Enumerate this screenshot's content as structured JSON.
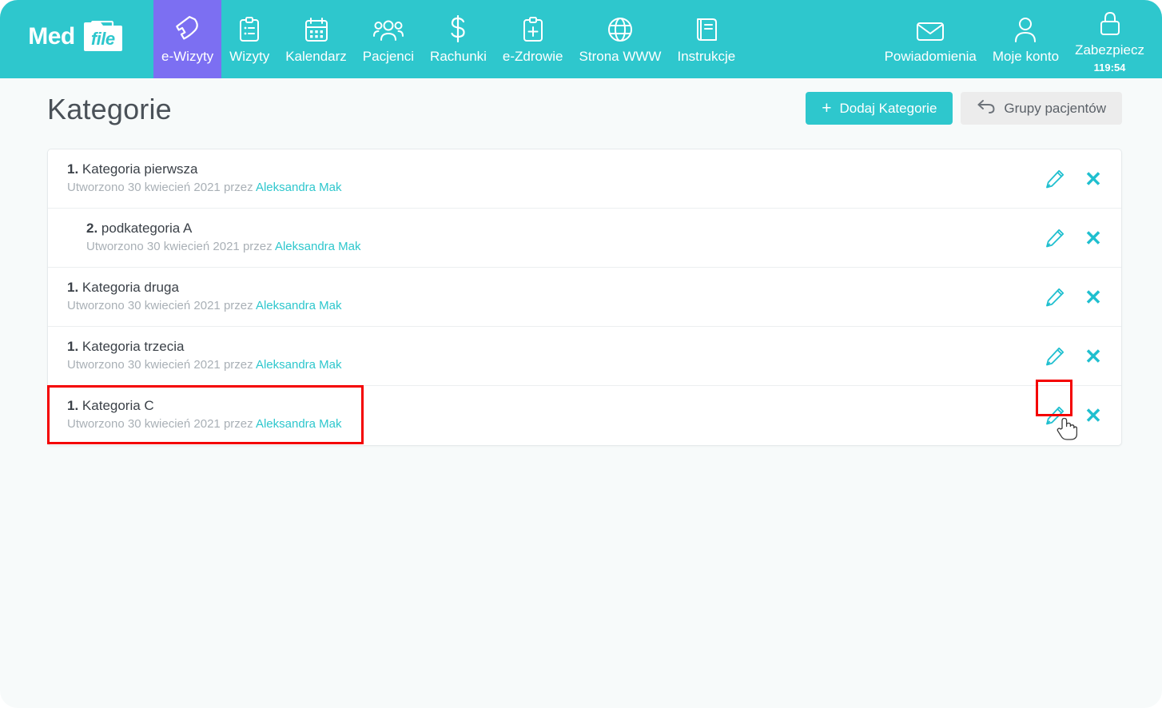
{
  "brand": {
    "logo_primary": "Med",
    "logo_secondary": "file",
    "accent_color": "#2ec7cd",
    "active_nav_color": "#7c6ff2",
    "highlight_color": "#f40000",
    "link_color": "#2ec7cd"
  },
  "nav": {
    "left_items": [
      {
        "label": "e-Wizyty",
        "icon": "phone-handset-icon",
        "active": true
      },
      {
        "label": "Wizyty",
        "icon": "clipboard-list-icon",
        "active": false
      },
      {
        "label": "Kalendarz",
        "icon": "calendar-icon",
        "active": false
      },
      {
        "label": "Pacjenci",
        "icon": "people-group-icon",
        "active": false
      },
      {
        "label": "Rachunki",
        "icon": "dollar-sign-icon",
        "active": false
      },
      {
        "label": "e-Zdrowie",
        "icon": "clipboard-cross-icon",
        "active": false
      },
      {
        "label": "Strona WWW",
        "icon": "globe-icon",
        "active": false
      },
      {
        "label": "Instrukcje",
        "icon": "book-icon",
        "active": false
      }
    ],
    "right_items": [
      {
        "label": "Powiadomienia",
        "icon": "envelope-icon",
        "sub": ""
      },
      {
        "label": "Moje konto",
        "icon": "user-icon",
        "sub": ""
      },
      {
        "label": "Zabezpiecz",
        "icon": "lock-icon",
        "sub": "119:54"
      }
    ]
  },
  "header": {
    "title": "Kategorie",
    "add_button": {
      "label": "Dodaj Kategorie",
      "plus": "+"
    },
    "groups_button": {
      "label": "Grupy pacjentów",
      "icon": "back-arrow-icon"
    }
  },
  "list": {
    "rows": [
      {
        "number": "1.",
        "name": "Kategoria pierwsza",
        "meta_prefix": "Utworzono 30 kwiecień 2021 przez",
        "author": "Aleksandra Mak",
        "indent": false,
        "highlighted": false,
        "edit_icon": "pencil-icon",
        "delete_icon": "close-x-icon"
      },
      {
        "number": "2.",
        "name": "podkategoria A",
        "meta_prefix": "Utworzono 30 kwiecień 2021 przez",
        "author": "Aleksandra Mak",
        "indent": true,
        "highlighted": false,
        "edit_icon": "pencil-icon",
        "delete_icon": "close-x-icon"
      },
      {
        "number": "1.",
        "name": "Kategoria druga",
        "meta_prefix": "Utworzono 30 kwiecień 2021 przez",
        "author": "Aleksandra Mak",
        "indent": false,
        "highlighted": false,
        "edit_icon": "pencil-icon",
        "delete_icon": "close-x-icon"
      },
      {
        "number": "1.",
        "name": "Kategoria trzecia",
        "meta_prefix": "Utworzono 30 kwiecień 2021 przez",
        "author": "Aleksandra Mak",
        "indent": false,
        "highlighted": false,
        "edit_icon": "pencil-icon",
        "delete_icon": "close-x-icon"
      },
      {
        "number": "1.",
        "name": "Kategoria C",
        "meta_prefix": "Utworzono 30 kwiecień 2021 przez",
        "author": "Aleksandra Mak",
        "indent": false,
        "highlighted": true,
        "edit_icon": "pencil-icon",
        "delete_icon": "close-x-icon"
      }
    ]
  },
  "cursor": {
    "type": "pointing-hand-cursor"
  }
}
